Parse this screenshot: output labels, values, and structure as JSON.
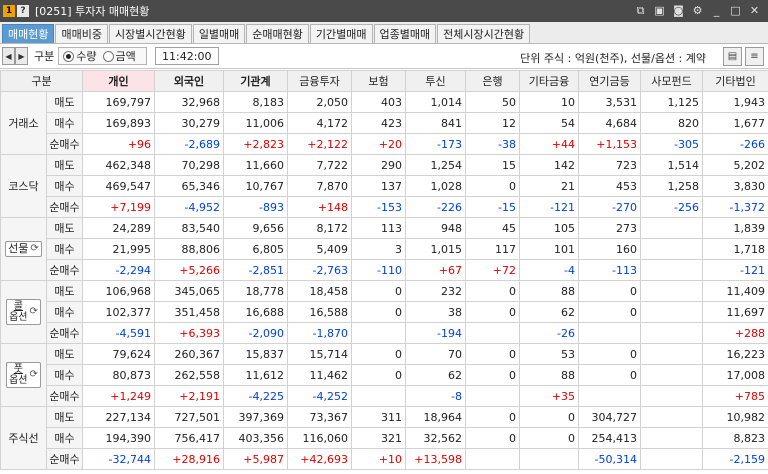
{
  "titlebar": {
    "badge_one": "1",
    "badge_q": "?",
    "title": "[0251] 투자자 매매현황",
    "icons": [
      "link-icon",
      "popup-icon",
      "camera-icon",
      "settings-icon",
      "minimize-icon",
      "maximize-icon",
      "close-icon"
    ],
    "icon_glyphs": [
      "⧉",
      "▣",
      "◙",
      "⚙",
      "_",
      "□",
      "✕"
    ]
  },
  "tabs": [
    "매매현황",
    "매매비중",
    "시장별시간현황",
    "일별매매",
    "순매매현황",
    "기간별매매",
    "업종별매매",
    "전체시장시간현황"
  ],
  "active_tab": 0,
  "toolbar": {
    "prev_glyph": "◀",
    "next_glyph": "▶",
    "label": "구분",
    "radio_qty": "수량",
    "radio_amt": "금액",
    "selected": "수량",
    "time": "11:42:00",
    "unit_text": "단위 주식 : 억원(천주), 선물/옵션 : 계약",
    "grid_icon_glyph": "▤",
    "list_icon_glyph": "≡"
  },
  "columns": [
    "구분",
    "",
    "개인",
    "외국인",
    "기관계",
    "금융투자",
    "보험",
    "투신",
    "은행",
    "기타금융",
    "연기금등",
    "사모펀드",
    "기타법인"
  ],
  "sub_labels": {
    "sell": "매도",
    "buy": "매수",
    "net": "순매수"
  },
  "refresh_glyph": "⟳",
  "groups": [
    {
      "name": "거래소",
      "button": false,
      "sell": [
        "169,797",
        "32,968",
        "8,183",
        "2,050",
        "403",
        "1,014",
        "50",
        "10",
        "3,531",
        "1,125",
        "1,943"
      ],
      "buy": [
        "169,893",
        "30,279",
        "11,006",
        "4,172",
        "423",
        "841",
        "12",
        "54",
        "4,684",
        "820",
        "1,677"
      ],
      "net": [
        "+96",
        "-2,689",
        "+2,823",
        "+2,122",
        "+20",
        "-173",
        "-38",
        "+44",
        "+1,153",
        "-305",
        "-266"
      ]
    },
    {
      "name": "코스닥",
      "button": false,
      "sell": [
        "462,348",
        "70,298",
        "11,660",
        "7,722",
        "290",
        "1,254",
        "15",
        "142",
        "723",
        "1,514",
        "5,202"
      ],
      "buy": [
        "469,547",
        "65,346",
        "10,767",
        "7,870",
        "137",
        "1,028",
        "0",
        "21",
        "453",
        "1,258",
        "3,830"
      ],
      "net": [
        "+7,199",
        "-4,952",
        "-893",
        "+148",
        "-153",
        "-226",
        "-15",
        "-121",
        "-270",
        "-256",
        "-1,372"
      ]
    },
    {
      "name": "선물",
      "button": true,
      "two_line": false,
      "sell": [
        "24,289",
        "83,540",
        "9,656",
        "8,172",
        "113",
        "948",
        "45",
        "105",
        "273",
        "",
        "1,839"
      ],
      "buy": [
        "21,995",
        "88,806",
        "6,805",
        "5,409",
        "3",
        "1,015",
        "117",
        "101",
        "160",
        "",
        "1,718"
      ],
      "net": [
        "-2,294",
        "+5,266",
        "-2,851",
        "-2,763",
        "-110",
        "+67",
        "+72",
        "-4",
        "-113",
        "",
        "-121"
      ]
    },
    {
      "name": "콜옵션",
      "button": true,
      "two_line": true,
      "line1": "콜",
      "line2": "옵션",
      "sell": [
        "106,968",
        "345,065",
        "18,778",
        "18,458",
        "0",
        "232",
        "0",
        "88",
        "0",
        "",
        "11,409"
      ],
      "buy": [
        "102,377",
        "351,458",
        "16,688",
        "16,588",
        "0",
        "38",
        "0",
        "62",
        "0",
        "",
        "11,697"
      ],
      "net": [
        "-4,591",
        "+6,393",
        "-2,090",
        "-1,870",
        "",
        "-194",
        "",
        "-26",
        "",
        "",
        "+288"
      ]
    },
    {
      "name": "풋옵션",
      "button": true,
      "two_line": true,
      "line1": "풋",
      "line2": "옵션",
      "sell": [
        "79,624",
        "260,367",
        "15,837",
        "15,714",
        "0",
        "70",
        "0",
        "53",
        "0",
        "",
        "16,223"
      ],
      "buy": [
        "80,873",
        "262,558",
        "11,612",
        "11,462",
        "0",
        "62",
        "0",
        "88",
        "0",
        "",
        "17,008"
      ],
      "net": [
        "+1,249",
        "+2,191",
        "-4,225",
        "-4,252",
        "",
        "-8",
        "",
        "+35",
        "",
        "",
        "+785"
      ]
    },
    {
      "name": "주식선",
      "button": false,
      "sell": [
        "227,134",
        "727,501",
        "397,369",
        "73,367",
        "311",
        "18,964",
        "0",
        "0",
        "304,727",
        "",
        "10,982"
      ],
      "buy": [
        "194,390",
        "756,417",
        "403,356",
        "116,060",
        "321",
        "32,562",
        "0",
        "0",
        "254,413",
        "",
        "8,823"
      ],
      "net": [
        "-32,744",
        "+28,916",
        "+5,987",
        "+42,693",
        "+10",
        "+13,598",
        "",
        "",
        "-50,314",
        "",
        "-2,159"
      ]
    }
  ],
  "colors": {
    "positive": "#e00000",
    "negative": "#0040e0",
    "active_tab": "#5a9bd4",
    "individual_header": "#fbe3e8"
  }
}
